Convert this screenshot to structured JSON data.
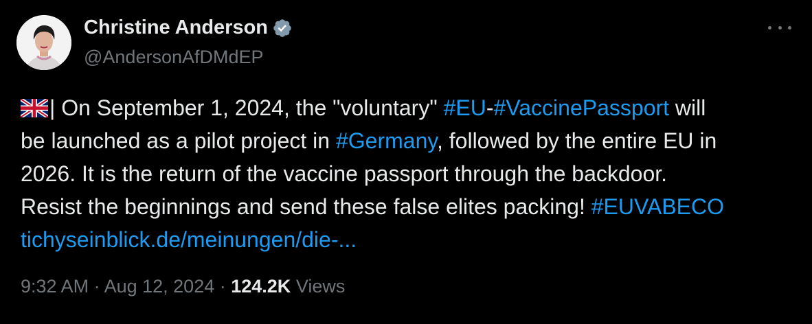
{
  "author": {
    "name": "Christine Anderson",
    "handle": "@AndersonAfDMdEP",
    "verified_icon": "verified-badge-icon",
    "avatar_icon": "profile-photo"
  },
  "menu": {
    "more_icon": "more-options-icon"
  },
  "tweet": {
    "flag_icon": "uk-flag-icon",
    "line1_a": "| On September 1, 2024, the \"voluntary\" ",
    "line1_tag1": "#EU",
    "line1_dash": "-",
    "line1_tag2": "#VaccinePassport",
    "line1_b": " will",
    "line2_a": "be launched as a pilot project in ",
    "line2_tag": "#Germany",
    "line2_b": ", followed by the entire EU in",
    "line3": "2026. It is the return of the vaccine passport through the backdoor.",
    "line4_a": "Resist the beginnings and send these false elites packing! ",
    "line4_tag": "#EUVABECO",
    "link": "tichyseinblick.de/meinungen/die-..."
  },
  "meta": {
    "time": "9:32 AM",
    "sep1": " · ",
    "date": "Aug 12, 2024",
    "sep2": " · ",
    "views_count": "124.2K",
    "views_label": " Views"
  },
  "colors": {
    "background": "#000000",
    "text": "#e7e9ea",
    "secondary": "#71767b",
    "link": "#1d9bf0",
    "verified": "#829aab"
  }
}
